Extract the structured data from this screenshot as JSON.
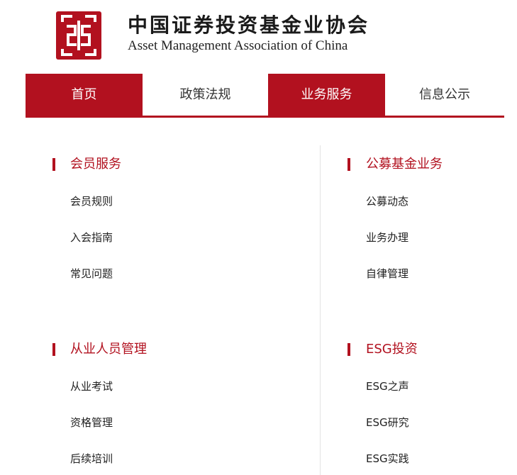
{
  "header": {
    "title_zh": "中国证券投资基金业协会",
    "title_en": "Asset Management Association of China"
  },
  "nav": {
    "items": [
      {
        "label": "首页",
        "active": true
      },
      {
        "label": "政策法规",
        "active": false
      },
      {
        "label": "业务服务",
        "active": true
      },
      {
        "label": "信息公示",
        "active": false
      }
    ]
  },
  "colors": {
    "brand_red": "#b2111f"
  },
  "sections": [
    {
      "title": "会员服务",
      "links": [
        "会员规则",
        "入会指南",
        "常见问题"
      ]
    },
    {
      "title": "公募基金业务",
      "links": [
        "公募动态",
        "业务办理",
        "自律管理"
      ]
    },
    {
      "title": "从业人员管理",
      "links": [
        "从业考试",
        "资格管理",
        "后续培训"
      ]
    },
    {
      "title": "ESG投资",
      "links": [
        "ESG之声",
        "ESG研究",
        "ESG实践"
      ]
    }
  ]
}
